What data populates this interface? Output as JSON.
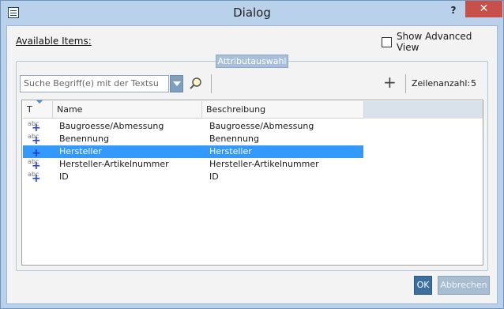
{
  "window": {
    "title": "Dialog",
    "help_label": "?",
    "close_label": "✕"
  },
  "available_items_label": "Available Items:",
  "advanced_view": {
    "label": "Show Advanced View",
    "checked": false
  },
  "group": {
    "title": "Attributauswahl"
  },
  "search": {
    "placeholder": "Suche Begriff(e) mit der Textsu"
  },
  "toolbar": {
    "add_label": "+",
    "row_count_label": "Zeilenanzahl:",
    "row_count": "5"
  },
  "table": {
    "headers": {
      "type": "T",
      "name": "Name",
      "description": "Beschreibung"
    },
    "rows": [
      {
        "type_icon": "text-attribute-icon",
        "name": "Baugroesse/Abmessung",
        "description": "Baugroesse/Abmessung",
        "selected": false
      },
      {
        "type_icon": "text-attribute-icon",
        "name": "Benennung",
        "description": "Benennung",
        "selected": false
      },
      {
        "type_icon": "attribute-icon",
        "name": "Hersteller",
        "description": "Hersteller",
        "selected": true
      },
      {
        "type_icon": "text-attribute-icon",
        "name": "Hersteller-Artikelnummer",
        "description": "Hersteller-Artikelnummer",
        "selected": false
      },
      {
        "type_icon": "text-attribute-icon",
        "name": "ID",
        "description": "ID",
        "selected": false
      }
    ]
  },
  "buttons": {
    "ok": "OK",
    "cancel": "Abbrechen"
  },
  "colors": {
    "selection": "#3399ff",
    "close": "#c7504b",
    "accent": "#3c6e9e"
  }
}
